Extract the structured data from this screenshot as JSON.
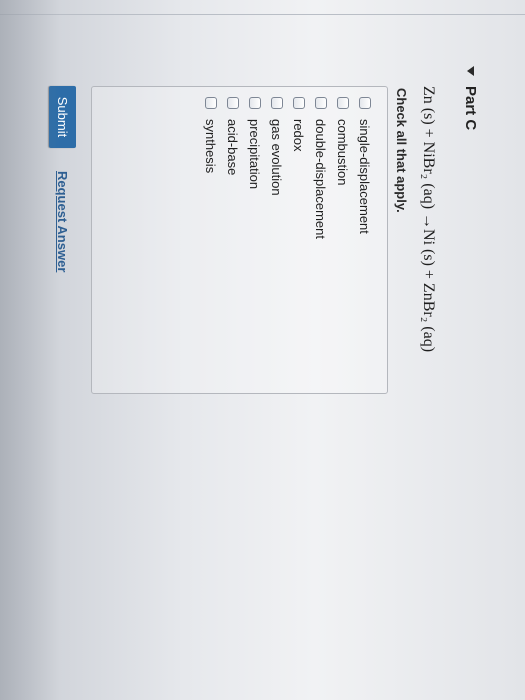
{
  "part": {
    "title": "Part C"
  },
  "question": {
    "equation": "Zn (s) + NiBr₂ (aq) →Ni (s) + ZnBr₂ (aq)",
    "instruction": "Check all that apply."
  },
  "options": [
    {
      "label": "single-displacement",
      "checked": false
    },
    {
      "label": "combustion",
      "checked": false
    },
    {
      "label": "double-displacement",
      "checked": false
    },
    {
      "label": "redox",
      "checked": false
    },
    {
      "label": "gas evolution",
      "checked": false
    },
    {
      "label": "precipitation",
      "checked": false
    },
    {
      "label": "acid-base",
      "checked": false
    },
    {
      "label": "synthesis",
      "checked": false
    }
  ],
  "actions": {
    "submit_label": "Submit",
    "request_answer_label": "Request Answer"
  },
  "colors": {
    "submit_bg": "#2d6da8",
    "link": "#2e5f92"
  }
}
